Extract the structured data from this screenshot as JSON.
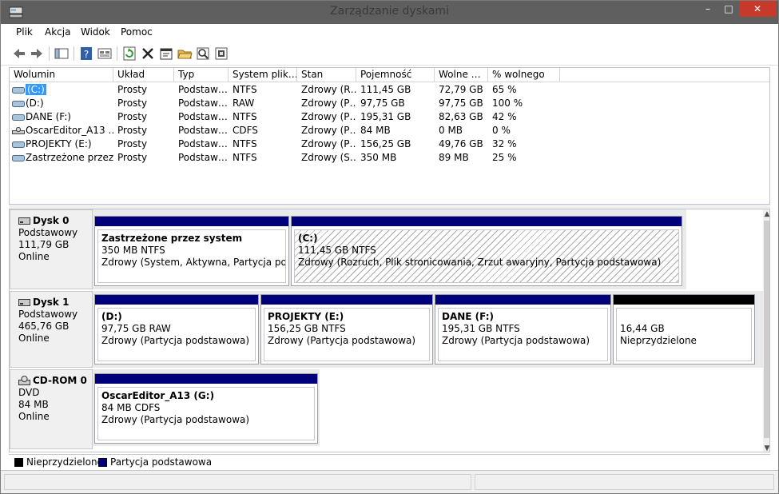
{
  "window": {
    "title": "Zarządzanie dyskami",
    "minimize": "–",
    "maximize": "□",
    "close": "✕"
  },
  "menu": [
    "Plik",
    "Akcja",
    "Widok",
    "Pomoc"
  ],
  "toolbar": [
    "back-icon",
    "forward-icon",
    "show-hide-tree-icon",
    "help-icon",
    "properties-view-icon",
    "refresh-icon",
    "delete-icon",
    "properties-icon",
    "open-icon",
    "explore-icon",
    "settings-icon"
  ],
  "table": {
    "headers": [
      "Wolumin",
      "Układ",
      "Typ",
      "System plik…",
      "Stan",
      "Pojemność",
      "Wolne …",
      "% wolnego"
    ],
    "rows": [
      [
        "(C:)",
        "Prosty",
        "Podstaw…",
        "NTFS",
        "Zdrowy (R…",
        "111,45 GB",
        "72,79 GB",
        "65 %"
      ],
      [
        "(D:)",
        "Prosty",
        "Podstaw…",
        "RAW",
        "Zdrowy (P…",
        "97,75 GB",
        "97,75 GB",
        "100 %"
      ],
      [
        "DANE (F:)",
        "Prosty",
        "Podstaw…",
        "NTFS",
        "Zdrowy (P…",
        "195,31 GB",
        "82,63 GB",
        "42 %"
      ],
      [
        "OscarEditor_A13 …",
        "Prosty",
        "Podstaw…",
        "CDFS",
        "Zdrowy (P…",
        "84 MB",
        "0 MB",
        "0 %"
      ],
      [
        "PROJEKTY (E:)",
        "Prosty",
        "Podstaw…",
        "NTFS",
        "Zdrowy (P…",
        "156,25 GB",
        "49,76 GB",
        "32 %"
      ],
      [
        "Zastrzeżone przez …",
        "Prosty",
        "Podstaw…",
        "NTFS",
        "Zdrowy (S…",
        "350 MB",
        "89 MB",
        "25 %"
      ]
    ]
  },
  "disks": [
    {
      "name": "Dysk 0",
      "type": "Podstawowy",
      "size": "111,79 GB",
      "status": "Online",
      "partitions": [
        {
          "name": "Zastrzeżone przez system",
          "size": "350 MB NTFS",
          "status": "Zdrowy (System, Aktywna, Partycja podstaw"
        },
        {
          "name": "(C:)",
          "size": "111,45 GB NTFS",
          "status": "Zdrowy (Rozruch, Plik stronicowania, Zrzut awaryjny, Partycja podstawowa)"
        }
      ]
    },
    {
      "name": "Dysk 1",
      "type": "Podstawowy",
      "size": "465,76 GB",
      "status": "Online",
      "partitions": [
        {
          "name": "(D:)",
          "size": "97,75 GB RAW",
          "status": "Zdrowy (Partycja podstawowa)"
        },
        {
          "name": "PROJEKTY  (E:)",
          "size": "156,25 GB NTFS",
          "status": "Zdrowy (Partycja podstawowa)"
        },
        {
          "name": "DANE  (F:)",
          "size": "195,31 GB NTFS",
          "status": "Zdrowy (Partycja podstawowa)"
        },
        {
          "name": "",
          "size": "16,44 GB",
          "status": "Nieprzydzielone"
        }
      ]
    },
    {
      "name": "CD-ROM 0",
      "type": "DVD",
      "size": "84 MB",
      "status": "Online",
      "partitions": [
        {
          "name": "OscarEditor_A13  (G:)",
          "size": "84 MB CDFS",
          "status": "Zdrowy (Partycja podstawowa)"
        }
      ]
    }
  ],
  "legend": [
    {
      "label": "Nieprzydzielone",
      "color": "#000000"
    },
    {
      "label": "Partycja podstawowa",
      "color": "#00007b"
    }
  ],
  "colors": {
    "primary_partition": "#00007b",
    "unallocated": "#000000",
    "selection": "#3399ff",
    "close_button": "#c7392b"
  }
}
